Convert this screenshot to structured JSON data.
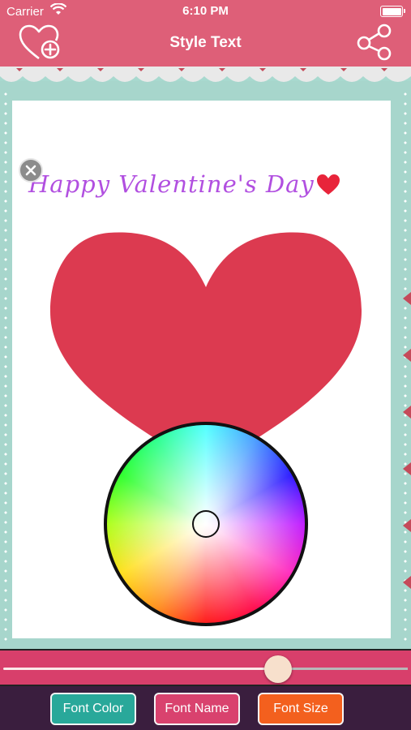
{
  "status_bar": {
    "carrier": "Carrier",
    "time": "6:10 PM"
  },
  "nav": {
    "title": "Style Text",
    "left_icon": "heart-plus-icon",
    "right_icon": "share-icon"
  },
  "canvas": {
    "text": "Happy Valentine's Day",
    "text_color": "#b14fe0",
    "heart_color": "#dc3a50",
    "emoji": "red-heart-emoji"
  },
  "color_picker": {
    "type": "color-wheel"
  },
  "slider": {
    "value": 0.68
  },
  "toolbar": {
    "font_color": "Font Color",
    "font_name": "Font Name",
    "font_size": "Font Size",
    "colors": {
      "font_color": "#29a89a",
      "font_name": "#d9426e",
      "font_size": "#f3601e"
    }
  }
}
